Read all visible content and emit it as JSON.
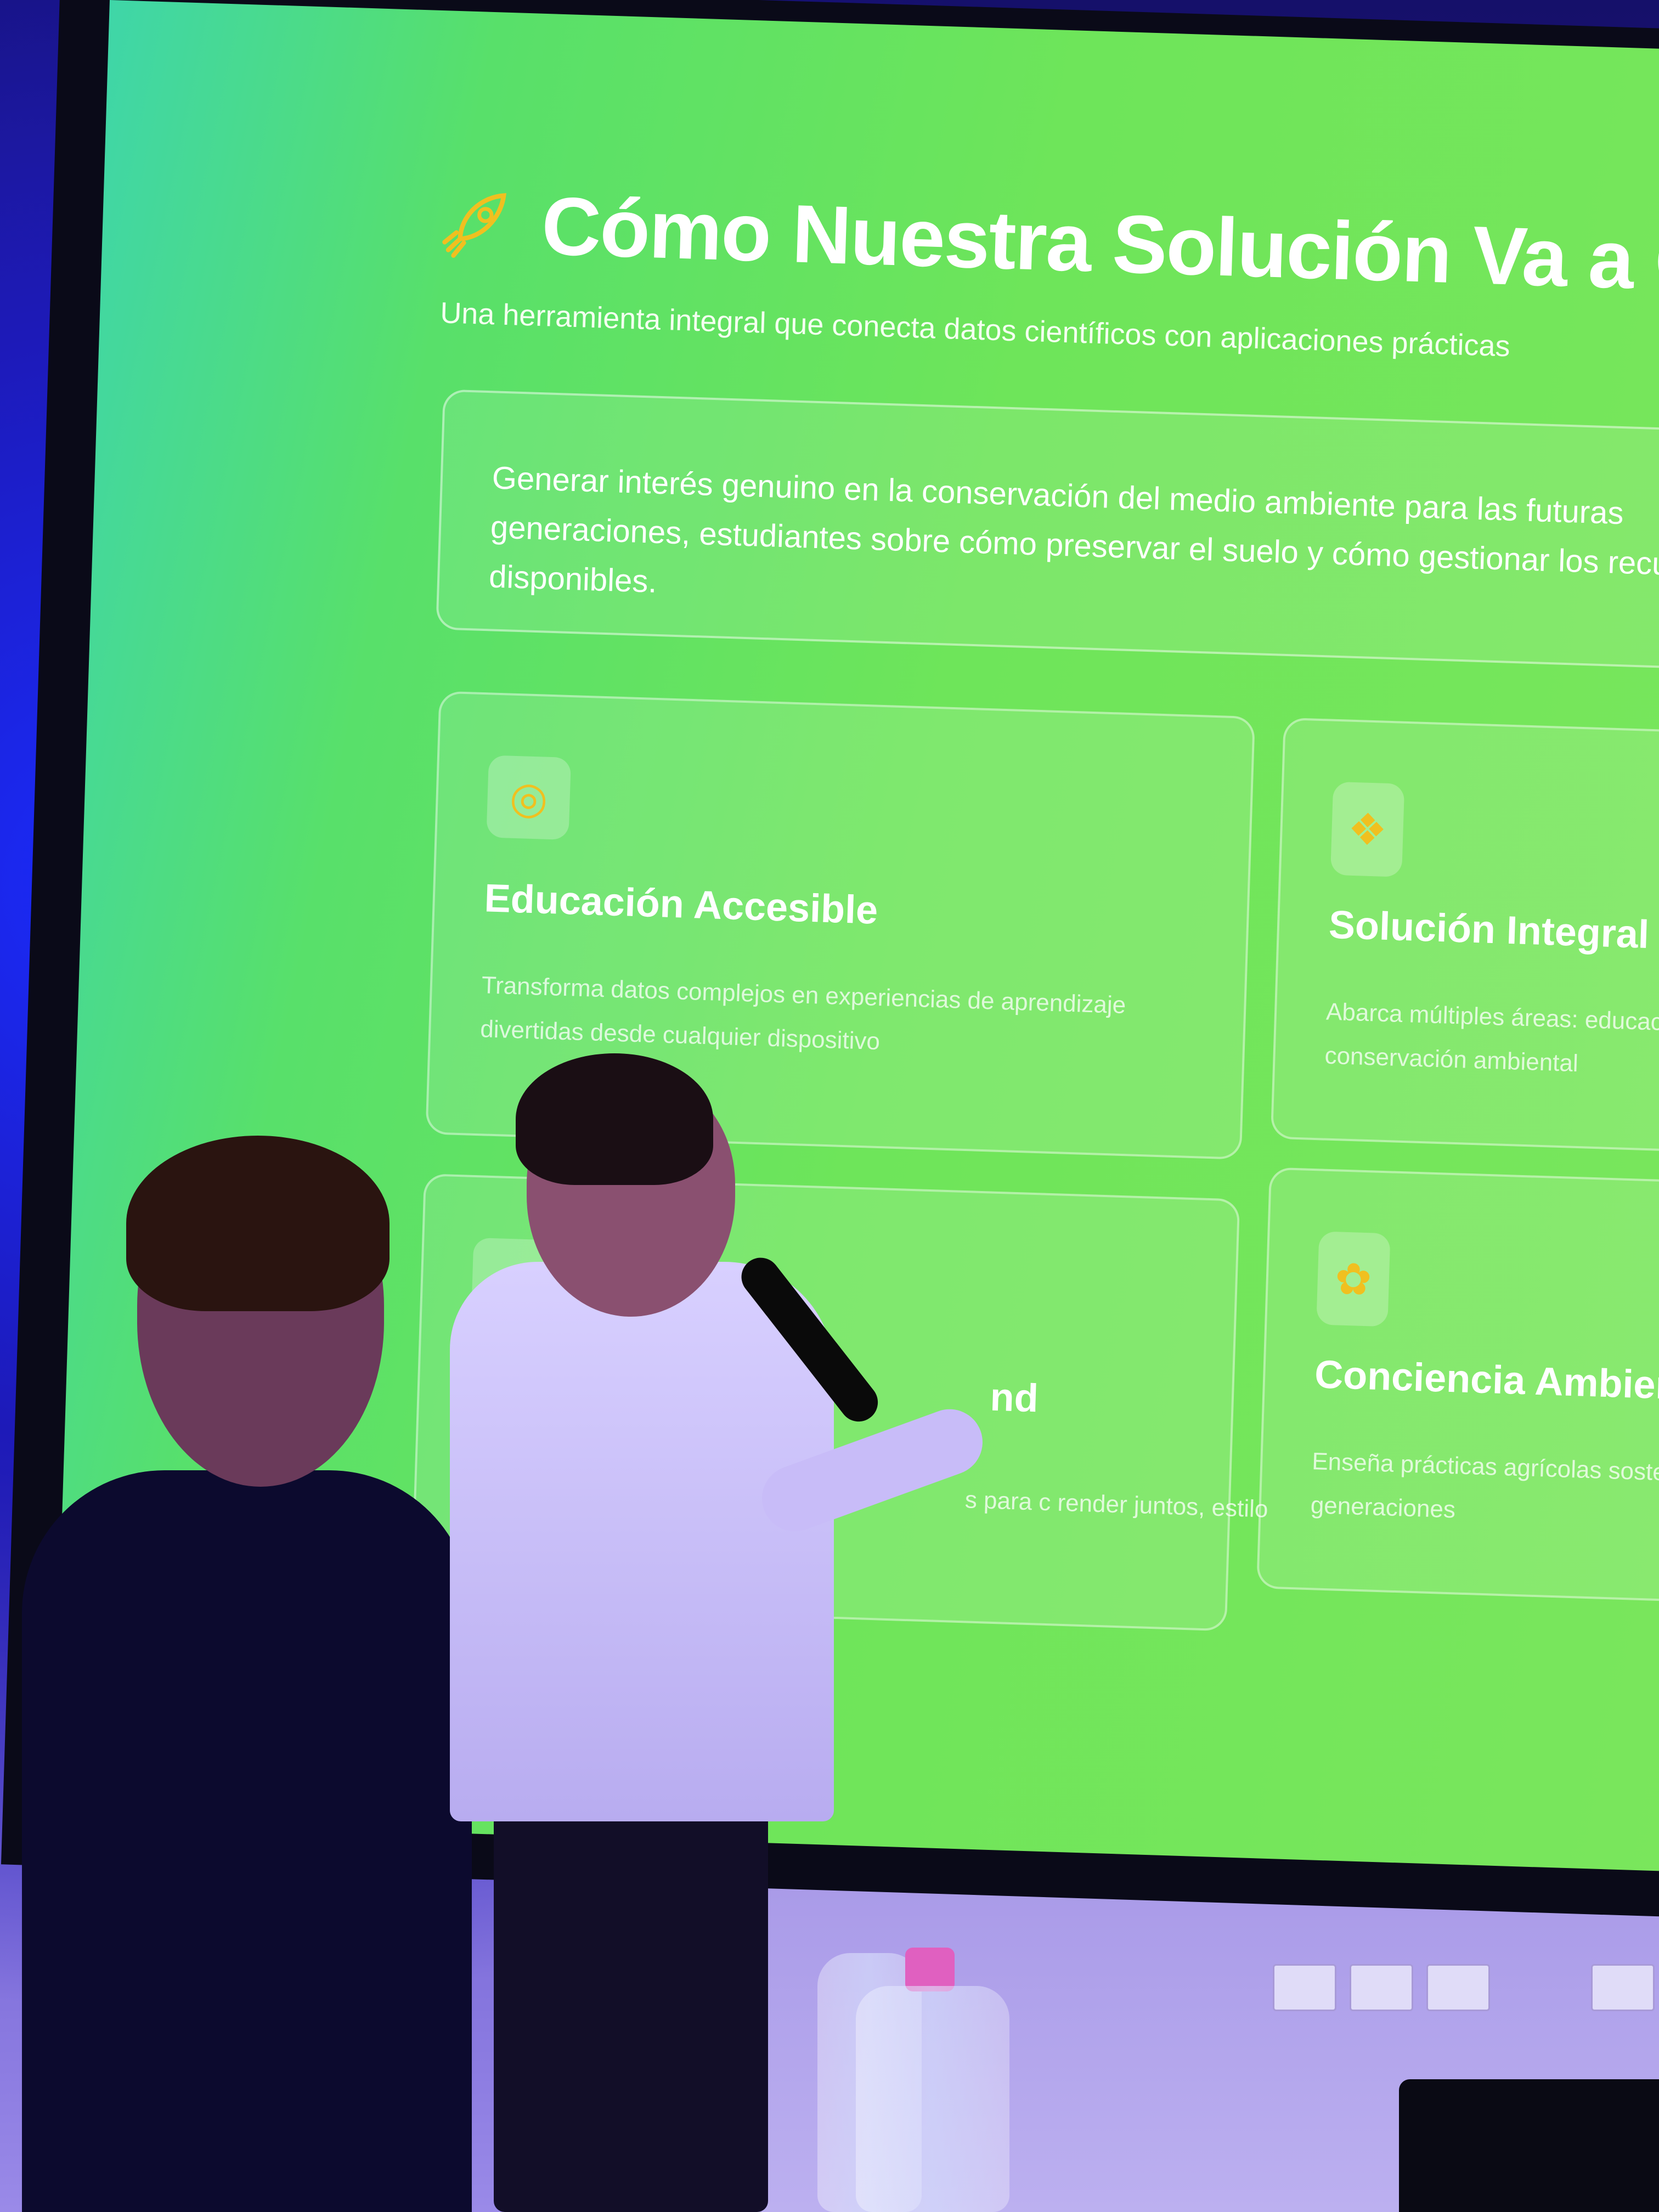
{
  "slide": {
    "title": "Cómo Nuestra Solución Va a Cambiar",
    "subtitle": "Una herramienta integral que conecta datos científicos con aplicaciones prácticas",
    "goal_text": "Generar interés genuino en la conservación del medio ambiente para las futuras generaciones, estudiantes sobre cómo preservar el suelo y cómo gestionar los recursos disponibles.",
    "cards": [
      {
        "title": "Educación Accesible",
        "description": "Transforma datos complejos en experiencias de aprendizaje divertidas desde cualquier dispositivo",
        "icon": "globe-icon"
      },
      {
        "title": "Solución Integral",
        "description": "Abarca múltiples áreas: educación conservación ambiental",
        "icon": "puzzle-icon"
      },
      {
        "title": "nd",
        "description": "s para c     render juntos, estilo",
        "icon": "people-icon"
      },
      {
        "title": "Conciencia Ambienta",
        "description": "Enseña prácticas agrícolas soste futuras generaciones",
        "icon": "sprout-icon"
      }
    ]
  },
  "colors": {
    "slide_bg_left": "#3fd6a8",
    "slide_bg_right": "#7ae65c",
    "icon_accent": "#f0c020",
    "room_light": "#1d1ab8"
  }
}
